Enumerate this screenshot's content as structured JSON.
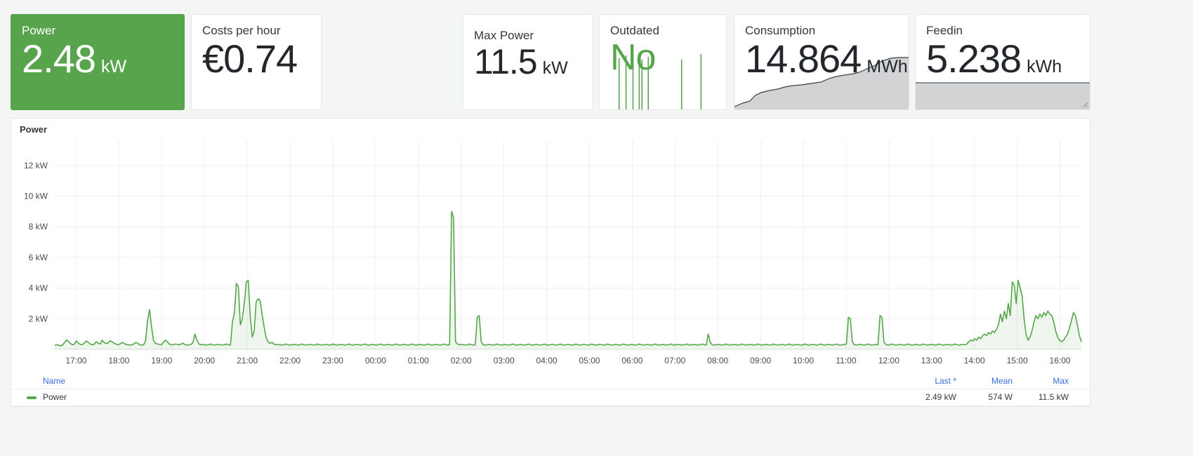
{
  "stats": [
    {
      "title": "Power",
      "value": "2.48",
      "unit": "kW",
      "highlight": true,
      "color": "#57a44c",
      "sparkline": null
    },
    {
      "title": "Costs per hour",
      "value": "€0.74",
      "unit": "",
      "highlight": false,
      "sparkline": null
    },
    {
      "title": "Max Power",
      "value": "11.5",
      "unit": "kW",
      "highlight": false,
      "sparkline": null
    },
    {
      "title": "Outdated",
      "value": "No",
      "unit": "",
      "highlight": false,
      "value_color": "#57a44c",
      "sparkline": "spikes"
    },
    {
      "title": "Consumption",
      "value": "14.864",
      "unit": "MWh",
      "highlight": false,
      "sparkline": "rising-area"
    },
    {
      "title": "Feedin",
      "value": "5.238",
      "unit": "kWh",
      "highlight": false,
      "sparkline": "flat-area"
    }
  ],
  "timeseries_panel": {
    "title": "Power"
  },
  "legend": {
    "columns": [
      "Name",
      "Last *",
      "Mean",
      "Max"
    ],
    "rows": [
      {
        "name": "Power",
        "color": "#56a64b",
        "last": "2.49 kW",
        "mean": "574 W",
        "max": "11.5 kW"
      }
    ]
  },
  "chart_data": {
    "type": "line",
    "title": "Power",
    "xlabel": "",
    "ylabel": "",
    "ylim": [
      0,
      13
    ],
    "yticks": [
      2,
      4,
      6,
      8,
      10,
      12
    ],
    "ytick_labels": [
      "2 kW",
      "4 kW",
      "6 kW",
      "8 kW",
      "10 kW",
      "12 kW"
    ],
    "grid": true,
    "legend_position": "bottom",
    "xtick_labels": [
      "17:00",
      "18:00",
      "19:00",
      "20:00",
      "21:00",
      "22:00",
      "23:00",
      "00:00",
      "01:00",
      "02:00",
      "03:00",
      "04:00",
      "05:00",
      "06:00",
      "07:00",
      "08:00",
      "09:00",
      "10:00",
      "11:00",
      "12:00",
      "13:00",
      "14:00",
      "15:00",
      "16:00"
    ],
    "series": [
      {
        "name": "Power",
        "color": "#56a64b",
        "unit": "kW",
        "values": [
          0.25,
          0.3,
          0.28,
          0.22,
          0.3,
          0.45,
          0.62,
          0.5,
          0.38,
          0.3,
          0.35,
          0.55,
          0.4,
          0.32,
          0.3,
          0.42,
          0.55,
          0.45,
          0.35,
          0.3,
          0.33,
          0.5,
          0.4,
          0.35,
          0.6,
          0.45,
          0.38,
          0.42,
          0.55,
          0.5,
          0.4,
          0.35,
          0.3,
          0.35,
          0.45,
          0.4,
          0.32,
          0.3,
          0.28,
          0.3,
          0.35,
          0.45,
          0.4,
          0.3,
          0.28,
          0.3,
          0.55,
          1.9,
          2.6,
          1.5,
          0.6,
          0.4,
          0.35,
          0.32,
          0.3,
          0.45,
          0.6,
          0.5,
          0.35,
          0.3,
          0.3,
          0.35,
          0.32,
          0.3,
          0.35,
          0.4,
          0.3,
          0.28,
          0.3,
          0.32,
          0.45,
          1.0,
          0.6,
          0.35,
          0.3,
          0.32,
          0.3,
          0.28,
          0.3,
          0.35,
          0.3,
          0.28,
          0.3,
          0.32,
          0.3,
          0.28,
          0.3,
          0.35,
          0.3,
          0.28,
          1.8,
          2.4,
          4.3,
          4.1,
          1.6,
          2.0,
          3.0,
          4.4,
          4.5,
          2.2,
          0.8,
          1.2,
          3.1,
          3.3,
          3.2,
          2.3,
          1.5,
          0.8,
          0.5,
          0.4,
          0.45,
          0.35,
          0.3,
          0.32,
          0.3,
          0.28,
          0.3,
          0.35,
          0.3,
          0.28,
          0.3,
          0.32,
          0.3,
          0.28,
          0.3,
          0.35,
          0.3,
          0.28,
          0.3,
          0.32,
          0.3,
          0.28,
          0.3,
          0.35,
          0.3,
          0.28,
          0.3,
          0.32,
          0.3,
          0.28,
          0.3,
          0.35,
          0.3,
          0.28,
          0.3,
          0.32,
          0.3,
          0.28,
          0.3,
          0.35,
          0.3,
          0.28,
          0.3,
          0.32,
          0.3,
          0.28,
          0.3,
          0.35,
          0.3,
          0.28,
          0.3,
          0.32,
          0.3,
          0.28,
          0.3,
          0.35,
          0.3,
          0.28,
          0.3,
          0.32,
          0.3,
          0.28,
          0.3,
          0.35,
          0.3,
          0.28,
          0.3,
          0.32,
          0.3,
          0.28,
          0.3,
          0.35,
          0.3,
          0.28,
          0.3,
          0.32,
          0.3,
          0.28,
          0.3,
          0.35,
          0.3,
          0.28,
          0.3,
          0.32,
          0.3,
          0.28,
          0.3,
          0.35,
          0.3,
          0.28,
          0.3,
          9.0,
          8.6,
          0.5,
          0.35,
          0.3,
          0.32,
          0.3,
          0.28,
          0.3,
          0.35,
          0.3,
          0.28,
          0.3,
          2.1,
          2.2,
          0.5,
          0.3,
          0.28,
          0.3,
          0.32,
          0.3,
          0.28,
          0.3,
          0.35,
          0.3,
          0.28,
          0.3,
          0.32,
          0.3,
          0.28,
          0.3,
          0.35,
          0.3,
          0.28,
          0.3,
          0.32,
          0.3,
          0.28,
          0.3,
          0.35,
          0.3,
          0.28,
          0.3,
          0.32,
          0.3,
          0.28,
          0.3,
          0.35,
          0.3,
          0.28,
          0.3,
          0.32,
          0.3,
          0.28,
          0.3,
          0.35,
          0.3,
          0.28,
          0.3,
          0.32,
          0.3,
          0.28,
          0.3,
          0.35,
          0.3,
          0.28,
          0.3,
          0.32,
          0.3,
          0.28,
          0.3,
          0.35,
          0.3,
          0.28,
          0.3,
          0.32,
          0.3,
          0.28,
          0.3,
          0.35,
          0.3,
          0.28,
          0.3,
          0.32,
          0.3,
          0.28,
          0.3,
          0.35,
          0.3,
          0.28,
          0.3,
          0.32,
          0.3,
          0.28,
          0.3,
          0.35,
          0.3,
          0.28,
          0.3,
          0.32,
          0.3,
          0.28,
          0.3,
          0.35,
          0.3,
          0.28,
          0.3,
          0.32,
          0.3,
          0.28,
          0.3,
          0.35,
          0.3,
          0.28,
          0.3,
          0.32,
          0.3,
          0.28,
          0.3,
          0.35,
          0.3,
          0.28,
          0.3,
          0.32,
          0.3,
          0.28,
          0.3,
          0.35,
          0.3,
          0.28,
          1.0,
          0.45,
          0.3,
          0.28,
          0.3,
          0.32,
          0.3,
          0.28,
          0.3,
          0.35,
          0.3,
          0.28,
          0.3,
          0.32,
          0.3,
          0.28,
          0.3,
          0.35,
          0.3,
          0.28,
          0.3,
          0.32,
          0.3,
          0.28,
          0.3,
          0.35,
          0.3,
          0.28,
          0.3,
          0.32,
          0.3,
          0.28,
          0.3,
          0.35,
          0.3,
          0.28,
          0.3,
          0.32,
          0.3,
          0.28,
          0.3,
          0.35,
          0.3,
          0.28,
          0.3,
          0.32,
          0.3,
          0.28,
          0.3,
          0.35,
          0.3,
          0.28,
          0.3,
          0.32,
          0.3,
          0.28,
          0.3,
          0.35,
          0.3,
          0.28,
          0.3,
          0.32,
          0.3,
          0.28,
          0.3,
          0.35,
          0.3,
          0.28,
          0.3,
          0.32,
          0.35,
          2.1,
          2.0,
          0.5,
          0.3,
          0.28,
          0.3,
          0.32,
          0.3,
          0.28,
          0.3,
          0.35,
          0.3,
          0.28,
          0.3,
          0.32,
          0.3,
          2.2,
          2.1,
          0.5,
          0.3,
          0.28,
          0.3,
          0.35,
          0.3,
          0.28,
          0.3,
          0.32,
          0.3,
          0.28,
          0.3,
          0.35,
          0.3,
          0.28,
          0.3,
          0.32,
          0.3,
          0.28,
          0.3,
          0.35,
          0.3,
          0.28,
          0.3,
          0.32,
          0.3,
          0.28,
          0.3,
          0.35,
          0.3,
          0.28,
          0.3,
          0.32,
          0.3,
          0.28,
          0.3,
          0.35,
          0.3,
          0.28,
          0.3,
          0.32,
          0.3,
          0.35,
          0.5,
          0.6,
          0.55,
          0.7,
          0.6,
          0.8,
          0.7,
          0.9,
          1.0,
          0.9,
          1.1,
          1.0,
          1.2,
          1.1,
          1.3,
          1.6,
          2.3,
          1.8,
          2.5,
          2.0,
          3.0,
          2.2,
          4.4,
          4.2,
          3.0,
          4.5,
          4.0,
          3.5,
          2.0,
          1.0,
          0.6,
          0.8,
          1.2,
          1.8,
          2.2,
          2.0,
          2.3,
          2.1,
          2.4,
          2.2,
          2.5,
          2.3,
          2.2,
          1.8,
          1.2,
          0.8,
          0.6,
          0.5,
          0.6,
          0.8,
          1.0,
          1.4,
          1.9,
          2.4,
          2.2,
          1.6,
          0.9,
          0.5
        ]
      }
    ]
  }
}
